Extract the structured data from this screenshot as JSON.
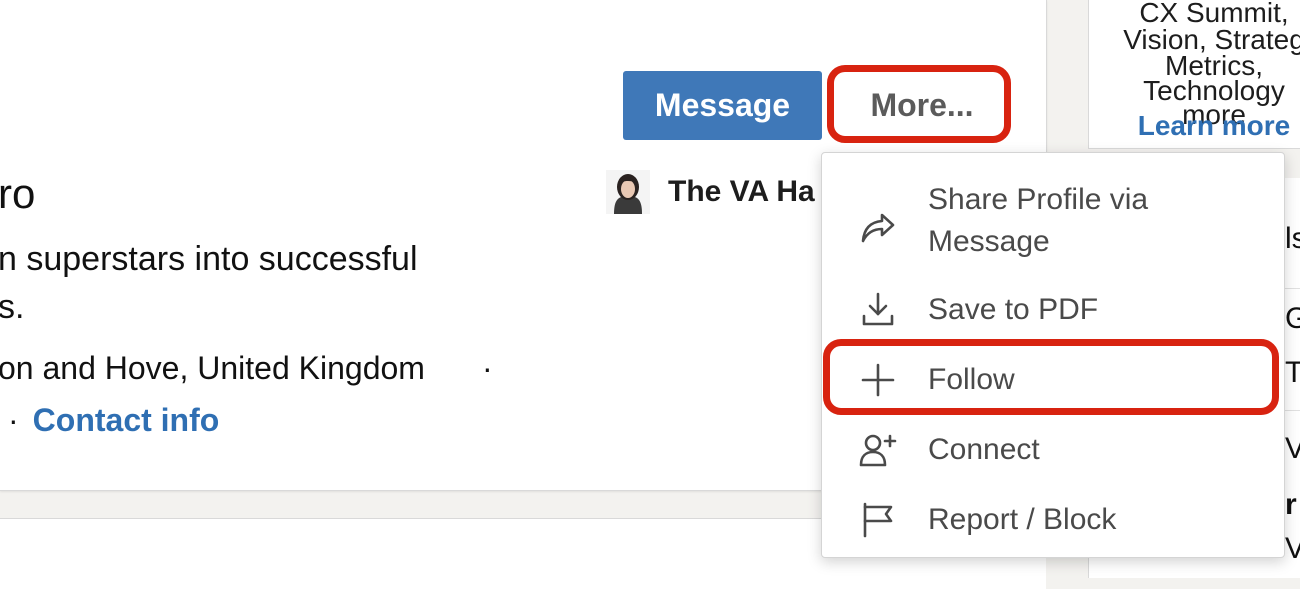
{
  "profile": {
    "name_fragment": "ro",
    "headline_line1": "n superstars into successful",
    "headline_line2": "s.",
    "location": "on and Hove, United Kingdom",
    "location_separator": "·",
    "contact_separator": "·",
    "contact_info": "Contact info",
    "company_name": "The VA Ha"
  },
  "actions": {
    "message_label": "Message",
    "more_label": "More..."
  },
  "dropdown": {
    "items": [
      {
        "label": "Share Profile via Message",
        "icon": "share-arrow-icon"
      },
      {
        "label": "Save to PDF",
        "icon": "download-icon"
      },
      {
        "label": "Follow",
        "icon": "plus-icon"
      },
      {
        "label": "Connect",
        "icon": "add-person-icon"
      },
      {
        "label": "Report / Block",
        "icon": "flag-icon"
      }
    ]
  },
  "ad": {
    "lines": [
      "CX Summit,",
      "Vision, Strateg",
      "Metrics,",
      "Technology",
      "more"
    ],
    "learn_more": "Learn more"
  },
  "side": {
    "fragments": [
      "ls",
      "G",
      "Tr",
      "V",
      "r",
      "Vi"
    ]
  },
  "colors": {
    "accent_blue": "#3f78b8",
    "link_blue": "#2f6fb3",
    "highlight_red": "#d82310"
  }
}
